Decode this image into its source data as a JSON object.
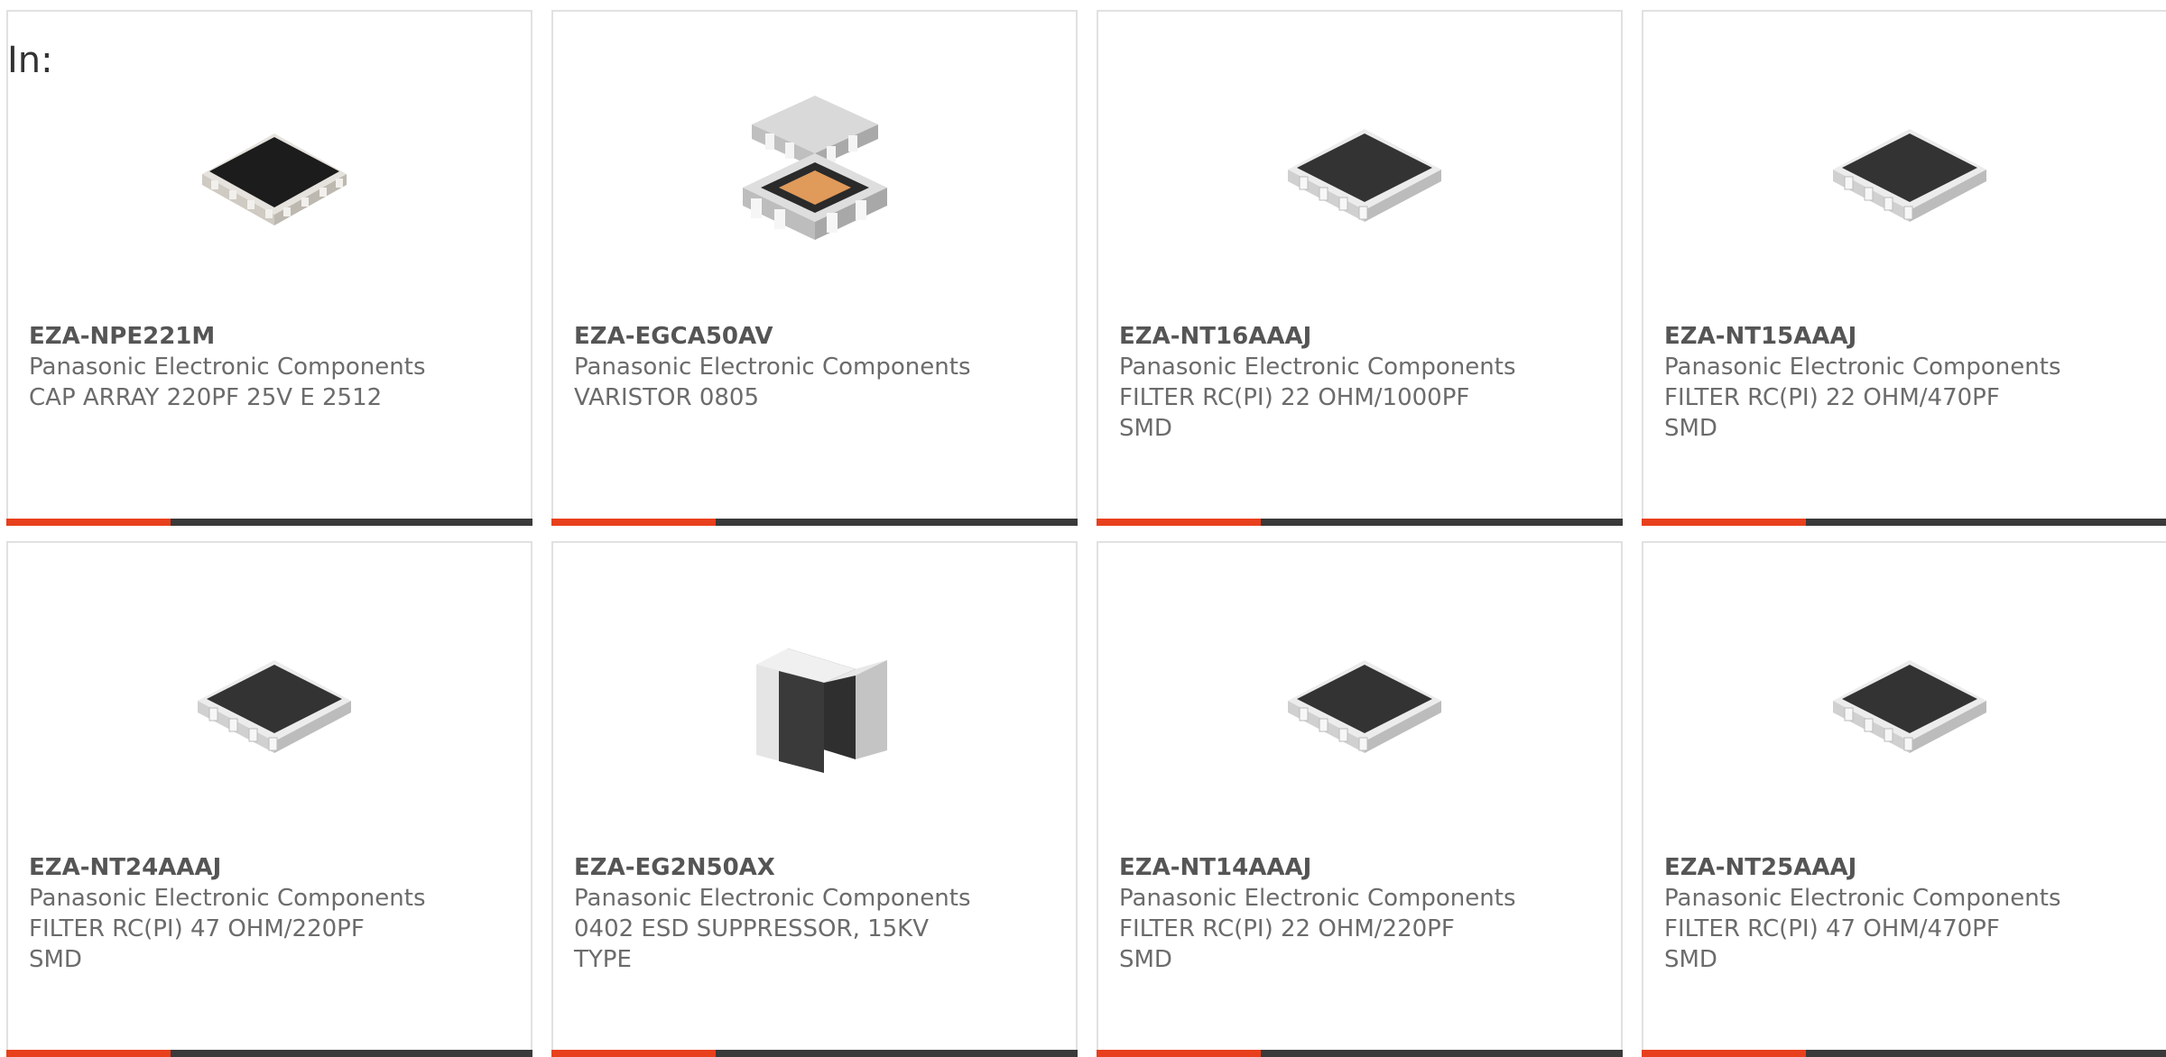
{
  "header": {
    "in_label": "In:"
  },
  "colors": {
    "accent_bar": "#e8401c",
    "dark_bar": "#3a3a3a",
    "card_border": "#e1e1e1",
    "text": "#6b6b6b"
  },
  "products": [
    {
      "part_number": "EZA-NPE221M",
      "manufacturer": "Panasonic Electronic Components",
      "description": "CAP ARRAY 220PF 25V E 2512",
      "image": "resistor-array-black-icon"
    },
    {
      "part_number": "EZA-EGCA50AV",
      "manufacturer": "Panasonic Electronic Components",
      "description": "VARISTOR 0805",
      "image": "varistor-array-exploded-icon"
    },
    {
      "part_number": "EZA-NT16AAAJ",
      "manufacturer": "Panasonic Electronic Components",
      "description": "FILTER RC(PI) 22 OHM/1000PF SMD",
      "image": "filter-array-icon"
    },
    {
      "part_number": "EZA-NT15AAAJ",
      "manufacturer": "Panasonic Electronic Components",
      "description": "FILTER RC(PI) 22 OHM/470PF SMD",
      "image": "filter-array-icon"
    },
    {
      "part_number": "EZA-NT24AAAJ",
      "manufacturer": "Panasonic Electronic Components",
      "description": "FILTER RC(PI) 47 OHM/220PF SMD",
      "image": "filter-array-icon"
    },
    {
      "part_number": "EZA-EG2N50AX",
      "manufacturer": "Panasonic Electronic Components",
      "description": "0402 ESD SUPPRESSOR, 15KV TYPE",
      "image": "chip-component-icon"
    },
    {
      "part_number": "EZA-NT14AAAJ",
      "manufacturer": "Panasonic Electronic Components",
      "description": "FILTER RC(PI) 22 OHM/220PF SMD",
      "image": "filter-array-icon"
    },
    {
      "part_number": "EZA-NT25AAAJ",
      "manufacturer": "Panasonic Electronic Components",
      "description": "FILTER RC(PI) 47 OHM/470PF SMD",
      "image": "filter-array-icon"
    }
  ]
}
